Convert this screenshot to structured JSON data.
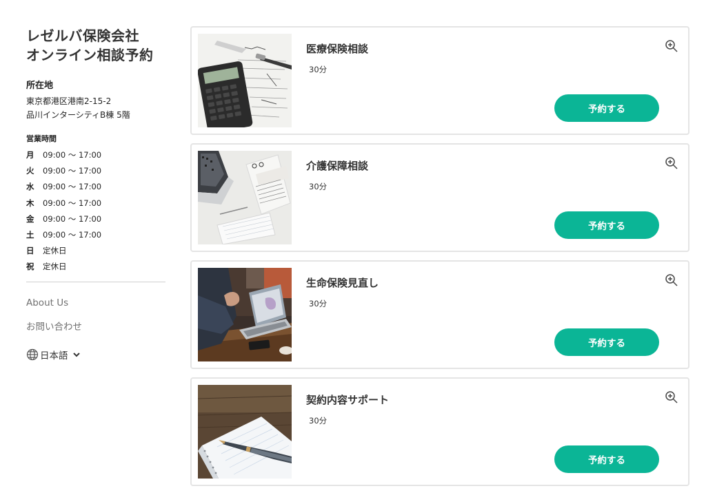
{
  "sidebar": {
    "title_line1": "レゼルバ保険会社",
    "title_line2": "オンライン相談予約",
    "address_label": "所在地",
    "address_line1": "東京都港区港南2-15-2",
    "address_line2": "品川インターシティB棟 5階",
    "hours_label": "営業時間",
    "hours": [
      {
        "day": "月",
        "time": "09:00 〜 17:00"
      },
      {
        "day": "火",
        "time": "09:00 〜 17:00"
      },
      {
        "day": "水",
        "time": "09:00 〜 17:00"
      },
      {
        "day": "木",
        "time": "09:00 〜 17:00"
      },
      {
        "day": "金",
        "time": "09:00 〜 17:00"
      },
      {
        "day": "土",
        "time": "09:00 〜 17:00"
      },
      {
        "day": "日",
        "time": "定休日"
      },
      {
        "day": "祝",
        "time": "定休日"
      }
    ],
    "links": [
      "About Us",
      "お問い合わせ"
    ],
    "language": "日本語",
    "icons": {
      "language": "globe-icon",
      "dropdown": "chevron-down-icon"
    }
  },
  "services": [
    {
      "title": "医療保険相談",
      "duration": "30分",
      "button": "予約する",
      "image": "calculator-photo"
    },
    {
      "title": "介護保障相談",
      "duration": "30分",
      "button": "予約する",
      "image": "desk-papers-photo"
    },
    {
      "title": "生命保険見直し",
      "duration": "30分",
      "button": "予約する",
      "image": "laptop-meeting-photo"
    },
    {
      "title": "契約内容サポート",
      "duration": "30分",
      "button": "予約する",
      "image": "notebook-pen-photo"
    }
  ],
  "colors": {
    "accent": "#0bb596",
    "border": "#e4e4e4",
    "link": "#707070"
  }
}
